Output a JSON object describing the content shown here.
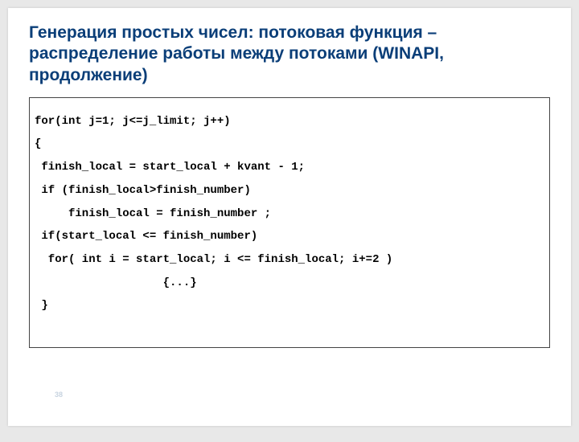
{
  "title": "Генерация простых чисел: потоковая функция – распределение работы между потоками (WINAPI, продолжение)",
  "code": {
    "l1": "for(int j=1; j<=j_limit; j++)",
    "l2": "{",
    "l3": " finish_local = start_local + kvant - 1;",
    "l4": " if (finish_local>finish_number)",
    "l5": "     finish_local = finish_number ;",
    "l6": " if(start_local <= finish_number)",
    "l7": "  for( int i = start_local; i <= finish_local; i+=2 )",
    "l8": "                   {...}",
    "l9": " }"
  },
  "page_num": "38"
}
